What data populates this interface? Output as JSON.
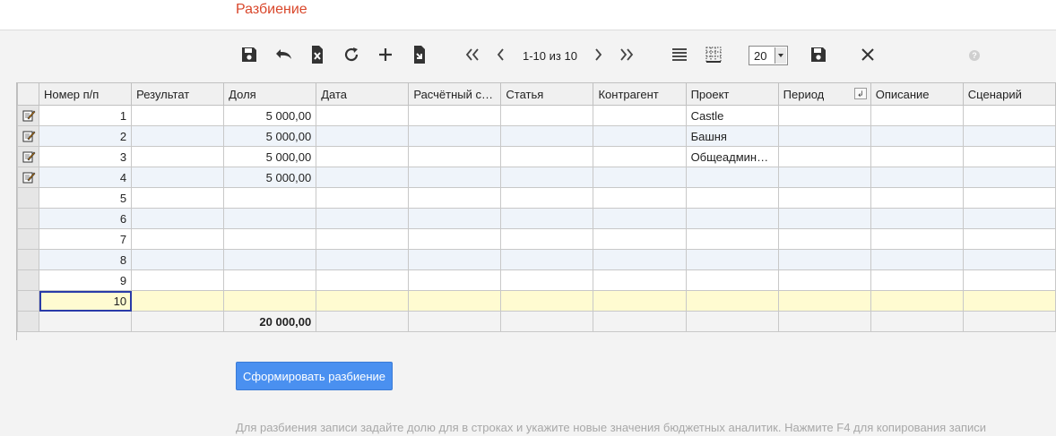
{
  "page": {
    "title": "Разбиение"
  },
  "toolbar": {
    "pager_text": "1-10 из 10",
    "page_size": "20",
    "icons": [
      "save-icon",
      "undo-icon",
      "delete-row-icon",
      "refresh-icon",
      "add-icon",
      "export-icon",
      "first-page-icon",
      "prev-page-icon",
      "next-page-icon",
      "last-page-icon",
      "rows-view-icon",
      "grid-lines-icon",
      "save-settings-icon",
      "close-icon",
      "help-icon"
    ],
    "help_glyph": "?"
  },
  "grid": {
    "columns": [
      "Номер п/п",
      "Результат",
      "Доля",
      "Дата",
      "Расчётный с…",
      "Статья",
      "Контрагент",
      "Проект",
      "Период",
      "Описание",
      "Сценарий"
    ],
    "rows": [
      {
        "n": "1",
        "result": "",
        "share": "5 000,00",
        "date": "",
        "account": "",
        "article": "",
        "counterparty": "",
        "project": "Castle",
        "period": "",
        "description": "",
        "scenario": ""
      },
      {
        "n": "2",
        "result": "",
        "share": "5 000,00",
        "date": "",
        "account": "",
        "article": "",
        "counterparty": "",
        "project": "Башня",
        "period": "",
        "description": "",
        "scenario": ""
      },
      {
        "n": "3",
        "result": "",
        "share": "5 000,00",
        "date": "",
        "account": "",
        "article": "",
        "counterparty": "",
        "project": "Общеадмини…",
        "period": "",
        "description": "",
        "scenario": ""
      },
      {
        "n": "4",
        "result": "",
        "share": "5 000,00",
        "date": "",
        "account": "",
        "article": "",
        "counterparty": "",
        "project": "",
        "period": "",
        "description": "",
        "scenario": ""
      },
      {
        "n": "5",
        "result": "",
        "share": "",
        "date": "",
        "account": "",
        "article": "",
        "counterparty": "",
        "project": "",
        "period": "",
        "description": "",
        "scenario": ""
      },
      {
        "n": "6",
        "result": "",
        "share": "",
        "date": "",
        "account": "",
        "article": "",
        "counterparty": "",
        "project": "",
        "period": "",
        "description": "",
        "scenario": ""
      },
      {
        "n": "7",
        "result": "",
        "share": "",
        "date": "",
        "account": "",
        "article": "",
        "counterparty": "",
        "project": "",
        "period": "",
        "description": "",
        "scenario": ""
      },
      {
        "n": "8",
        "result": "",
        "share": "",
        "date": "",
        "account": "",
        "article": "",
        "counterparty": "",
        "project": "",
        "period": "",
        "description": "",
        "scenario": ""
      },
      {
        "n": "9",
        "result": "",
        "share": "",
        "date": "",
        "account": "",
        "article": "",
        "counterparty": "",
        "project": "",
        "period": "",
        "description": "",
        "scenario": ""
      },
      {
        "n": "10",
        "result": "",
        "share": "",
        "date": "",
        "account": "",
        "article": "",
        "counterparty": "",
        "project": "",
        "period": "",
        "description": "",
        "scenario": ""
      }
    ],
    "total_share": "20 000,00"
  },
  "actions": {
    "form_button": "Сформировать разбиение"
  },
  "hint": "Для разбиения записи задайте долю для в строках и укажите новые значения бюджетных аналитик. Нажмите F4 для копирования записи",
  "colors": {
    "title": "#d9472b",
    "primary_button": "#4a90f0",
    "selected_row": "#fffbd1",
    "alt_row": "#eff4fa"
  }
}
